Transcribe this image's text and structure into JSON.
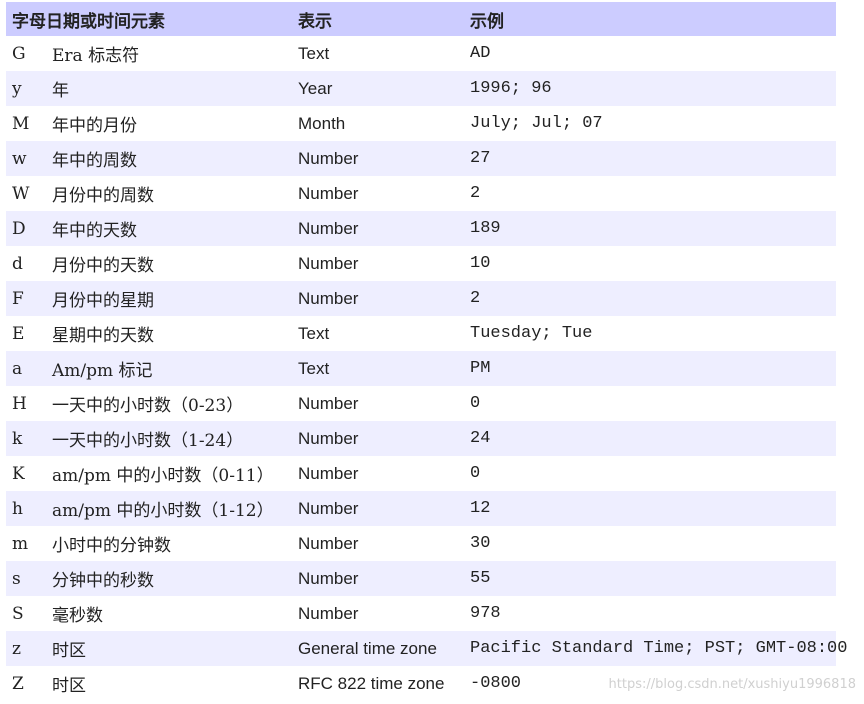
{
  "table": {
    "headers": [
      "字母日期或时间元素",
      "表示",
      "示例"
    ],
    "rows": [
      {
        "letter": "G",
        "component": "Era 标志符",
        "presentation": "Text",
        "example": "AD"
      },
      {
        "letter": "y",
        "component": "年",
        "presentation": "Year",
        "example": "1996; 96"
      },
      {
        "letter": "M",
        "component": "年中的月份",
        "presentation": "Month",
        "example": "July; Jul; 07"
      },
      {
        "letter": "w",
        "component": "年中的周数",
        "presentation": "Number",
        "example": "27"
      },
      {
        "letter": "W",
        "component": "月份中的周数",
        "presentation": "Number",
        "example": "2"
      },
      {
        "letter": "D",
        "component": "年中的天数",
        "presentation": "Number",
        "example": "189"
      },
      {
        "letter": "d",
        "component": "月份中的天数",
        "presentation": "Number",
        "example": "10"
      },
      {
        "letter": "F",
        "component": "月份中的星期",
        "presentation": "Number",
        "example": "2"
      },
      {
        "letter": "E",
        "component": "星期中的天数",
        "presentation": "Text",
        "example": "Tuesday; Tue"
      },
      {
        "letter": "a",
        "component": "Am/pm 标记",
        "presentation": "Text",
        "example": "PM"
      },
      {
        "letter": "H",
        "component": "一天中的小时数（0-23）",
        "presentation": "Number",
        "example": "0"
      },
      {
        "letter": "k",
        "component": "一天中的小时数（1-24）",
        "presentation": "Number",
        "example": "24"
      },
      {
        "letter": "K",
        "component": "am/pm 中的小时数（0-11）",
        "presentation": "Number",
        "example": "0"
      },
      {
        "letter": "h",
        "component": "am/pm 中的小时数（1-12）",
        "presentation": "Number",
        "example": "12"
      },
      {
        "letter": "m",
        "component": "小时中的分钟数",
        "presentation": "Number",
        "example": "30"
      },
      {
        "letter": "s",
        "component": "分钟中的秒数",
        "presentation": "Number",
        "example": "55"
      },
      {
        "letter": "S",
        "component": "毫秒数",
        "presentation": "Number",
        "example": "978"
      },
      {
        "letter": "z",
        "component": "时区",
        "presentation": "General time zone",
        "example": "Pacific Standard Time; PST; GMT-08:00"
      },
      {
        "letter": "Z",
        "component": "时区",
        "presentation": "RFC 822 time zone",
        "example": "-0800"
      }
    ]
  },
  "watermark": "https://blog.csdn.net/xushiyu1996818",
  "colors": {
    "header_bg": "#ccccff",
    "alt_row_bg": "#eeeeff",
    "presentation_text": "#2a70d8"
  }
}
